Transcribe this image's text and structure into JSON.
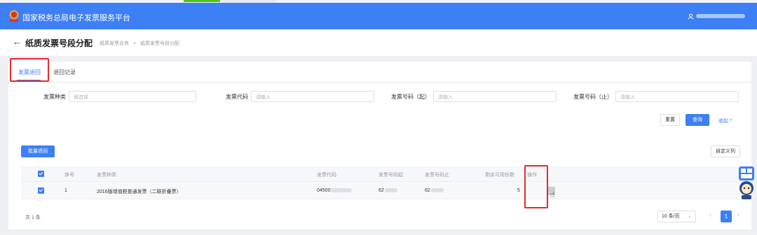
{
  "header": {
    "title": "国家税务总局电子发票服务平台"
  },
  "page": {
    "back_icon": "arrow-left-icon",
    "title": "纸质发票号段分配",
    "breadcrumb": [
      "纸质发票业务",
      ">",
      "纸质发票号段分配"
    ]
  },
  "tabs": [
    {
      "label": "发票退回",
      "active": true
    },
    {
      "label": "退回记录",
      "active": false
    }
  ],
  "filters": {
    "type": {
      "label": "发票种类",
      "placeholder": "请选择"
    },
    "code": {
      "label": "发票代码",
      "placeholder": "请输入"
    },
    "num_start": {
      "label": "发票号码（起）",
      "placeholder": "请输入"
    },
    "num_end": {
      "label": "发票号码（止）",
      "placeholder": "请输入"
    }
  },
  "actions": {
    "reset": "重置",
    "query": "查询",
    "collapse": "收起 ^"
  },
  "toolbar": {
    "batch_return": "批量退回",
    "custom_columns": "自定义列"
  },
  "table": {
    "columns": [
      "序号",
      "发票种类",
      "发票代码",
      "发票号码起",
      "发票号码止",
      "剩余可用份数",
      "操作"
    ],
    "rows": [
      {
        "index": "1",
        "type": "2016版增值税普通发票（二联折叠票）",
        "code": "04500",
        "num_start": "62",
        "num_end": "62",
        "remaining": "5"
      }
    ]
  },
  "footer": {
    "total": "共 1 条",
    "page_size": "10 条/页",
    "current_page": "1"
  },
  "colors": {
    "primary": "#3d7ff5",
    "highlight": "#e62b2b"
  }
}
